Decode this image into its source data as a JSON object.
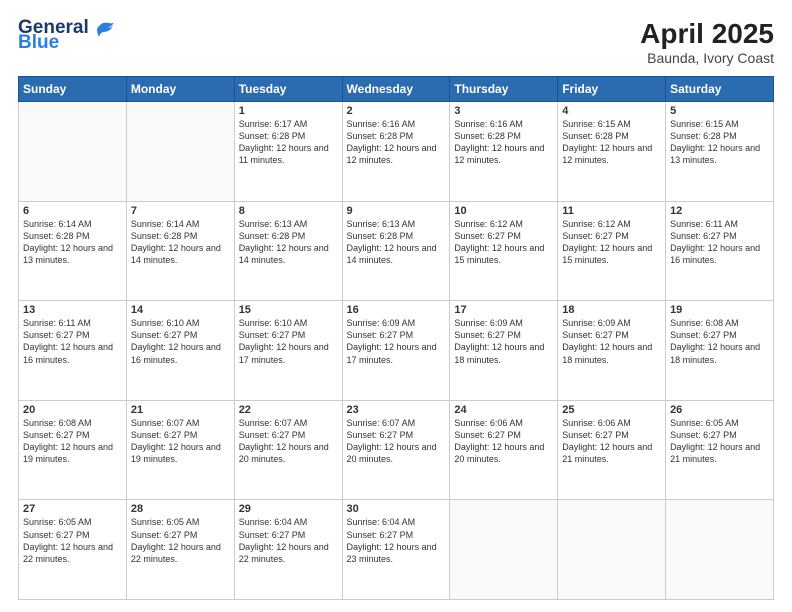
{
  "logo": {
    "line1": "General",
    "line2": "Blue"
  },
  "title": "April 2025",
  "subtitle": "Baunda, Ivory Coast",
  "days_of_week": [
    "Sunday",
    "Monday",
    "Tuesday",
    "Wednesday",
    "Thursday",
    "Friday",
    "Saturday"
  ],
  "weeks": [
    [
      {
        "day": "",
        "info": ""
      },
      {
        "day": "",
        "info": ""
      },
      {
        "day": "1",
        "info": "Sunrise: 6:17 AM\nSunset: 6:28 PM\nDaylight: 12 hours and 11 minutes."
      },
      {
        "day": "2",
        "info": "Sunrise: 6:16 AM\nSunset: 6:28 PM\nDaylight: 12 hours and 12 minutes."
      },
      {
        "day": "3",
        "info": "Sunrise: 6:16 AM\nSunset: 6:28 PM\nDaylight: 12 hours and 12 minutes."
      },
      {
        "day": "4",
        "info": "Sunrise: 6:15 AM\nSunset: 6:28 PM\nDaylight: 12 hours and 12 minutes."
      },
      {
        "day": "5",
        "info": "Sunrise: 6:15 AM\nSunset: 6:28 PM\nDaylight: 12 hours and 13 minutes."
      }
    ],
    [
      {
        "day": "6",
        "info": "Sunrise: 6:14 AM\nSunset: 6:28 PM\nDaylight: 12 hours and 13 minutes."
      },
      {
        "day": "7",
        "info": "Sunrise: 6:14 AM\nSunset: 6:28 PM\nDaylight: 12 hours and 14 minutes."
      },
      {
        "day": "8",
        "info": "Sunrise: 6:13 AM\nSunset: 6:28 PM\nDaylight: 12 hours and 14 minutes."
      },
      {
        "day": "9",
        "info": "Sunrise: 6:13 AM\nSunset: 6:28 PM\nDaylight: 12 hours and 14 minutes."
      },
      {
        "day": "10",
        "info": "Sunrise: 6:12 AM\nSunset: 6:27 PM\nDaylight: 12 hours and 15 minutes."
      },
      {
        "day": "11",
        "info": "Sunrise: 6:12 AM\nSunset: 6:27 PM\nDaylight: 12 hours and 15 minutes."
      },
      {
        "day": "12",
        "info": "Sunrise: 6:11 AM\nSunset: 6:27 PM\nDaylight: 12 hours and 16 minutes."
      }
    ],
    [
      {
        "day": "13",
        "info": "Sunrise: 6:11 AM\nSunset: 6:27 PM\nDaylight: 12 hours and 16 minutes."
      },
      {
        "day": "14",
        "info": "Sunrise: 6:10 AM\nSunset: 6:27 PM\nDaylight: 12 hours and 16 minutes."
      },
      {
        "day": "15",
        "info": "Sunrise: 6:10 AM\nSunset: 6:27 PM\nDaylight: 12 hours and 17 minutes."
      },
      {
        "day": "16",
        "info": "Sunrise: 6:09 AM\nSunset: 6:27 PM\nDaylight: 12 hours and 17 minutes."
      },
      {
        "day": "17",
        "info": "Sunrise: 6:09 AM\nSunset: 6:27 PM\nDaylight: 12 hours and 18 minutes."
      },
      {
        "day": "18",
        "info": "Sunrise: 6:09 AM\nSunset: 6:27 PM\nDaylight: 12 hours and 18 minutes."
      },
      {
        "day": "19",
        "info": "Sunrise: 6:08 AM\nSunset: 6:27 PM\nDaylight: 12 hours and 18 minutes."
      }
    ],
    [
      {
        "day": "20",
        "info": "Sunrise: 6:08 AM\nSunset: 6:27 PM\nDaylight: 12 hours and 19 minutes."
      },
      {
        "day": "21",
        "info": "Sunrise: 6:07 AM\nSunset: 6:27 PM\nDaylight: 12 hours and 19 minutes."
      },
      {
        "day": "22",
        "info": "Sunrise: 6:07 AM\nSunset: 6:27 PM\nDaylight: 12 hours and 20 minutes."
      },
      {
        "day": "23",
        "info": "Sunrise: 6:07 AM\nSunset: 6:27 PM\nDaylight: 12 hours and 20 minutes."
      },
      {
        "day": "24",
        "info": "Sunrise: 6:06 AM\nSunset: 6:27 PM\nDaylight: 12 hours and 20 minutes."
      },
      {
        "day": "25",
        "info": "Sunrise: 6:06 AM\nSunset: 6:27 PM\nDaylight: 12 hours and 21 minutes."
      },
      {
        "day": "26",
        "info": "Sunrise: 6:05 AM\nSunset: 6:27 PM\nDaylight: 12 hours and 21 minutes."
      }
    ],
    [
      {
        "day": "27",
        "info": "Sunrise: 6:05 AM\nSunset: 6:27 PM\nDaylight: 12 hours and 22 minutes."
      },
      {
        "day": "28",
        "info": "Sunrise: 6:05 AM\nSunset: 6:27 PM\nDaylight: 12 hours and 22 minutes."
      },
      {
        "day": "29",
        "info": "Sunrise: 6:04 AM\nSunset: 6:27 PM\nDaylight: 12 hours and 22 minutes."
      },
      {
        "day": "30",
        "info": "Sunrise: 6:04 AM\nSunset: 6:27 PM\nDaylight: 12 hours and 23 minutes."
      },
      {
        "day": "",
        "info": ""
      },
      {
        "day": "",
        "info": ""
      },
      {
        "day": "",
        "info": ""
      }
    ]
  ]
}
